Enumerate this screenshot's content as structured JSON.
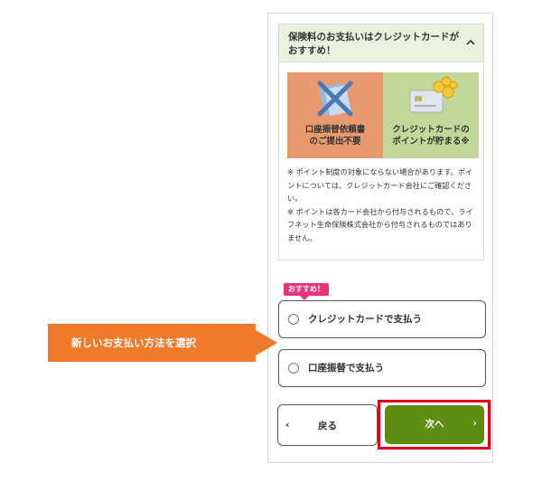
{
  "panel": {
    "title": "保険料のお支払いはクレジットカードがおすすめ！",
    "features": [
      {
        "label": "口座振替依頼書\nのご提出不要",
        "icon": "no-paper-icon",
        "color": "#e89a6e"
      },
      {
        "label": "クレジットカードの\nポイントが貯まる※",
        "icon": "credit-card-coins-icon",
        "color": "#c2d79a"
      }
    ],
    "notes": [
      "※ ポイント制度の対象にならない場合があります。ポイントについては、クレジットカード会社にご確認ください。",
      "※ ポイントは各カード会社から付与されるもので、ライフネット生命保険株式会社から付与されるものではありません。"
    ]
  },
  "recommend_badge": "おすすめ！",
  "options": [
    {
      "label": "クレジットカードで支払う"
    },
    {
      "label": "口座振替で支払う"
    }
  ],
  "callout": "新しいお支払い方法を選択",
  "buttons": {
    "back": "戻る",
    "next": "次へ"
  },
  "colors": {
    "accent_green": "#5f8d12",
    "callout_orange": "#ee7a2a",
    "badge_pink": "#e6357a",
    "highlight_red": "#e0001a"
  }
}
